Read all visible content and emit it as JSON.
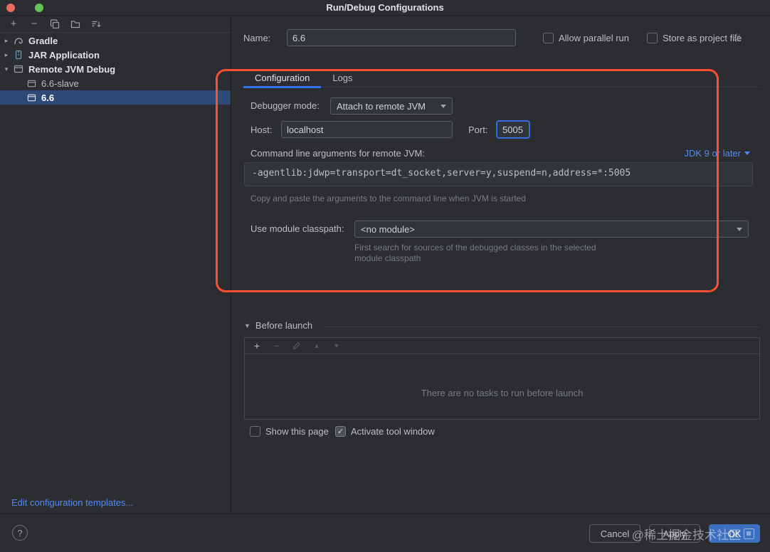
{
  "window": {
    "title": "Run/Debug Configurations"
  },
  "sidebar": {
    "tree": [
      {
        "label": "Gradle"
      },
      {
        "label": "JAR Application"
      },
      {
        "label": "Remote JVM Debug"
      },
      {
        "label": "6.6-slave"
      },
      {
        "label": "6.6"
      }
    ],
    "edit_templates": "Edit configuration templates..."
  },
  "header": {
    "name_label": "Name:",
    "name_value": "6.6",
    "allow_parallel_label": "Allow parallel run",
    "allow_parallel_checked": false,
    "store_project_label": "Store as project file",
    "store_project_checked": false
  },
  "tabs": [
    {
      "label": "Configuration",
      "active": true
    },
    {
      "label": "Logs",
      "active": false
    }
  ],
  "form": {
    "debugger_mode_label": "Debugger mode:",
    "debugger_mode_value": "Attach to remote JVM",
    "host_label": "Host:",
    "host_value": "localhost",
    "port_label": "Port:",
    "port_value": "5005",
    "cmdline_label": "Command line arguments for remote JVM:",
    "jdk_selector_value": "JDK 9 or later",
    "cmdline_value": "-agentlib:jdwp=transport=dt_socket,server=y,suspend=n,address=*:5005",
    "cmdline_hint": "Copy and paste the arguments to the command line when JVM is started",
    "module_label": "Use module classpath:",
    "module_value": "<no module>",
    "module_hint_line1": "First search for sources of the debugged classes in the selected",
    "module_hint_line2": "module classpath"
  },
  "before_launch": {
    "title": "Before launch",
    "empty_text": "There are no tasks to run before launch",
    "show_page_label": "Show this page",
    "show_page_checked": false,
    "activate_label": "Activate tool window",
    "activate_checked": true
  },
  "footer": {
    "help": "?",
    "cancel": "Cancel",
    "apply": "Apply",
    "ok": "OK"
  },
  "watermark": "@稀土掘金技术社区",
  "colors": {
    "accent": "#3574f0",
    "annotation": "#fc4e33",
    "selection": "#2e4976",
    "link": "#548af7"
  }
}
